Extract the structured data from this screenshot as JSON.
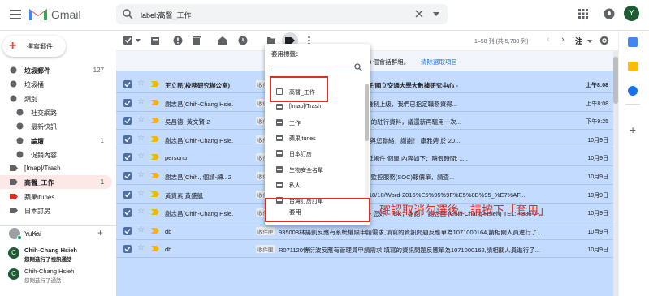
{
  "app": {
    "brand": "Gmail",
    "avatar_letter": "Y"
  },
  "search": {
    "query": "label:高醫_工作"
  },
  "sidebar": {
    "compose": "撰寫郵件",
    "items": [
      {
        "label": "垃圾郵件",
        "count": "127",
        "bold": true,
        "icon": "alert-icon"
      },
      {
        "label": "垃圾桶",
        "count": "",
        "bold": false,
        "icon": "trash-icon"
      },
      {
        "label": "類別",
        "count": "",
        "bold": false,
        "icon": "category-icon"
      },
      {
        "label": "社交網路",
        "count": "",
        "bold": false,
        "icon": "people-icon",
        "indent": true
      },
      {
        "label": "最新快訊",
        "count": "",
        "bold": false,
        "icon": "info-icon",
        "indent": true
      },
      {
        "label": "論壇",
        "count": "1",
        "bold": true,
        "icon": "forum-icon",
        "indent": true
      },
      {
        "label": "促銷內容",
        "count": "",
        "bold": false,
        "icon": "tag-icon",
        "indent": true
      },
      {
        "label": "[Imap]/Trash",
        "count": "",
        "bold": false,
        "icon": "label-icon"
      },
      {
        "label": "高醫_工作",
        "count": "1",
        "bold": true,
        "icon": "label-icon",
        "active": true
      },
      {
        "label": "蘋果itunes",
        "count": "",
        "bold": false,
        "icon": "label-red-icon"
      },
      {
        "label": "日本訂房",
        "count": "",
        "bold": false,
        "icon": "label-icon"
      }
    ],
    "hangouts_user": "YuKai",
    "chats": [
      {
        "initial": "C",
        "name": "Chih-Chang Hsieh",
        "sub": "您剛進行了視訊通話"
      },
      {
        "initial": "C",
        "name": "Chih-Chang Hsieh",
        "sub": "您剛進行了通話"
      }
    ]
  },
  "toolbar": {
    "pagination": "1–50 列 (共 5,708 列)",
    "lang": "注"
  },
  "selection_bar": {
    "text": "8 個會話群組。",
    "link": "清除選取項目"
  },
  "emails": [
    {
      "sender": "王立民(校務研究辦公室)",
      "chip": "收件匣",
      "subject": "8:00 勵學大樓視聽中心/王蕊君主任/國立交通大學大數據研究中心 -",
      "date": "上午8:08",
      "bold": true
    },
    {
      "sender": "謝志昌(Chih-Chang Hsie.",
      "chip": "收件匣",
      "subject": "上 5:54 被監用了，按系統的監控機制上級，我們已指定職務資得...",
      "date": "上午8:08",
      "bold": false
    },
    {
      "sender": "吳昌德, 黃文賢 2",
      "chip": "收件匣",
      "subject": "故障問題 - 同學 您好：已有除旗內的駐行資料，議還新再驅用一次...",
      "date": "下午9:25",
      "bold": false
    },
    {
      "sender": "謝志昌(Chih-Chang Hsie.",
      "chip": "收件匣",
      "subject": "：我們先研究看看，預計本週四再與您聯絡，謝謝！ 康雅娉 於 20...",
      "date": "10月9日",
      "bold": false
    },
    {
      "sender": "personu",
      "chip": "收件匣",
      "subject": "您好知下,隨意報：您好：您的 加延帳件 個單 內容如下：隨假時間: 1...",
      "date": "10月9日",
      "bold": false
    },
    {
      "sender": "謝志昌(Chih., 個請-練.. 2",
      "chip": "收件匣",
      "subject": "，事 - 組長： 收信好！附件為資安監控服務(SOC)報價單，請查...",
      "date": "10月9日",
      "bold": false
    },
    {
      "sender": "黃資素,黃盛凱",
      "chip": "收件匣",
      "subject": "ttps://wp.kmu.edu.tw/emp/files/2018/10/Word-2016%E5%95%9F%E5%8B%95_%E7%AF...",
      "date": "10月9日",
      "bold": false
    },
    {
      "sender": "謝志昌(Chih-Chang Hsie.",
      "chip": "收件匣",
      "subject": "Re: 定採10/12(五) AM9:30 - 蓋元 - 您好： OK，謝謝！ 謝志昌 (Chih-Chang Hsieh) TEL: +886-7-...",
      "date": "10月9日",
      "bold": false
    },
    {
      "sender": "db",
      "chip": "收件匣",
      "subject": "935008林揚凱反應有系統權限申請需求,填寫的資訊問題反應單為1071000164,請相關人員進行了...",
      "date": "10月9日",
      "bold": false
    },
    {
      "sender": "db",
      "chip": "收件匣",
      "subject": "R071120傳衍波反應有管理員申請需求,填寫的資訊問題反應單為1071000162,請相關人員進行了...",
      "date": "10月9日",
      "bold": false
    }
  ],
  "label_popup": {
    "title": "套用標籤：",
    "options": [
      {
        "label": "高醫_工作",
        "state": "empty"
      },
      {
        "label": "[Imap]/Trash",
        "state": "mixed"
      },
      {
        "label": "工作",
        "state": "mixed"
      },
      {
        "label": "蘋果itunes",
        "state": "mixed"
      },
      {
        "label": "日本訂房",
        "state": "mixed"
      },
      {
        "label": "生物安全名單",
        "state": "mixed"
      },
      {
        "label": "私人",
        "state": "mixed"
      },
      {
        "label": "台灣訂房訂單",
        "state": "mixed"
      }
    ],
    "apply": "套用"
  },
  "annotation": {
    "callout": "確認取消勾選後，請按下「套用」"
  },
  "colors": {
    "accent_red": "#d93025",
    "selected_row": "#c2dbff",
    "active_label": "#fce8e6"
  }
}
